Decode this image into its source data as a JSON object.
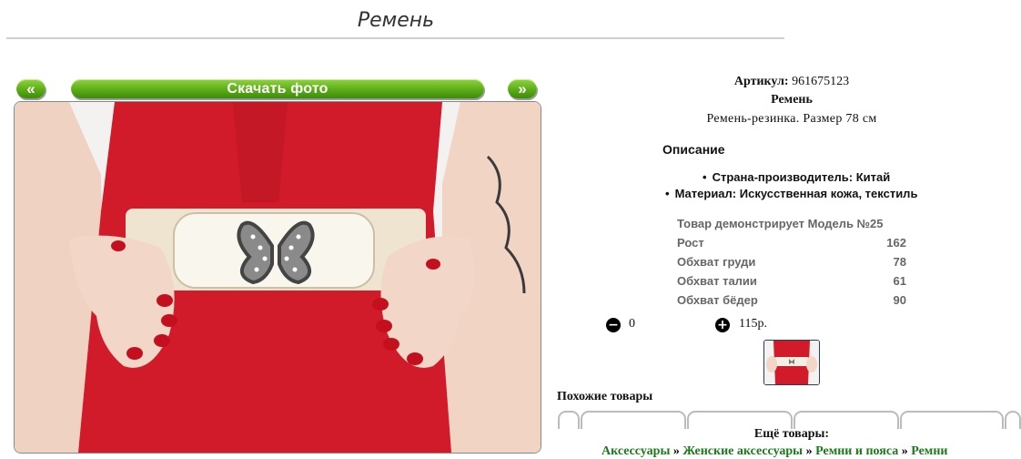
{
  "page": {
    "title": "Ремень"
  },
  "gallery": {
    "prev_label": "«",
    "next_label": "»",
    "download_label": "Скачать фото"
  },
  "product": {
    "sku_label": "Артикул:",
    "sku_value": "961675123",
    "name": "Ремень",
    "short_desc": "Ремень-резинка. Размер 78 см",
    "description_heading": "Описание",
    "features": [
      "Страна-производитель: Китай",
      "Материал: Искусственная кожа, текстиль"
    ],
    "model_params": {
      "heading": "Товар демонстрирует Модель №25",
      "rows": [
        {
          "label": "Рост",
          "value": "162"
        },
        {
          "label": "Обхват груди",
          "value": "78"
        },
        {
          "label": "Обхват талии",
          "value": "61"
        },
        {
          "label": "Обхват бёдер",
          "value": "90"
        }
      ]
    },
    "quantity": "0",
    "price": "115р."
  },
  "similar": {
    "heading": "Похожие товары"
  },
  "more": {
    "heading": "Ещё товары:",
    "breadcrumbs": [
      "Аксессуары",
      "Женские аксессуары",
      "Ремни и пояса",
      "Ремни"
    ],
    "separator": "»"
  },
  "colors": {
    "accent_green": "#5cac17",
    "dress_red": "#d11a2a",
    "link_green": "#1a7a1a"
  },
  "icons": {
    "minus": "minus-circle-icon",
    "plus": "plus-circle-icon"
  }
}
